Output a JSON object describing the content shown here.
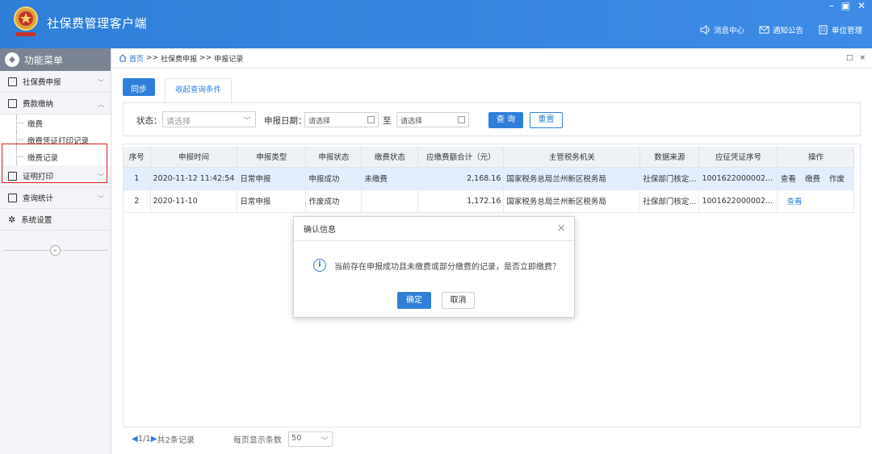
{
  "header": {
    "title": "社保费管理客户端",
    "logo_icon": "tax-emblem-icon",
    "window": {
      "minimize": "–",
      "restore": "▣",
      "close": "✕"
    },
    "links": [
      {
        "label": "消息中心",
        "icon": "speaker-icon"
      },
      {
        "label": "通知公告",
        "icon": "mail-icon"
      },
      {
        "label": "单位管理",
        "icon": "building-icon"
      }
    ]
  },
  "sidebar": {
    "title": "功能菜单",
    "items": [
      {
        "label": "社保费申报"
      },
      {
        "label": "费款缴纳"
      },
      {
        "label": "证明打印"
      },
      {
        "label": "查询统计"
      },
      {
        "label": "系统设置"
      }
    ],
    "sub_items": [
      "缴费",
      "缴费凭证打印记录",
      "缴费记录"
    ],
    "collapse": "«"
  },
  "breadcrumb": {
    "home": "首页",
    "sep": ">>",
    "level1": "社保费申报",
    "level2": "申报记录",
    "right_a": "□",
    "right_b": "×"
  },
  "toolbar": {
    "sync": "同步",
    "collapse_filter": "收起查询条件"
  },
  "filter": {
    "status_label": "状态：",
    "status_placeholder": "请选择",
    "date_label": "申报日期：",
    "date_from": "请选择",
    "to": "至",
    "date_to": "请选择",
    "query": "查 询",
    "reset": "重置"
  },
  "table": {
    "columns": [
      "序号",
      "申报时间",
      "申报类型",
      "申报状态",
      "缴费状态",
      "应缴费额合计（元）",
      "主管税务机关",
      "数据来源",
      "应征凭证序号",
      "操作"
    ],
    "rows": [
      {
        "no": "1",
        "time": "2020-11-12 11:42:54",
        "type": "日常申报",
        "status": "申报成功",
        "pay_status": "未缴费",
        "amount": "2,168.16",
        "authority": "国家税务总局兰州新区税务局",
        "source": "社保部门核定...",
        "voucher": "1001622000002...",
        "ops": [
          "查看",
          "缴费",
          "作废"
        ]
      },
      {
        "no": "2",
        "time": "2020-11-10",
        "type": "日常申报",
        "status": "作废成功",
        "pay_status": "",
        "amount": "1,172.16",
        "authority": "国家税务总局兰州新区税务局",
        "source": "社保部门核定...",
        "voucher": "1001622000002...",
        "ops": [
          "查看"
        ]
      }
    ]
  },
  "pager": {
    "prev": "◀",
    "page": "1/1",
    "next": "▶",
    "total": "共2条记录",
    "page_size_label": "每页显示条数",
    "page_size": "50"
  },
  "modal": {
    "title": "确认信息",
    "message": "当前存在申报成功且未缴费或部分缴费的记录，是否立即缴费？",
    "ok": "确定",
    "cancel": "取消",
    "close": "×"
  },
  "colors": {
    "primary": "#2f7fd9",
    "highlight": "#e01e1e",
    "sidebar_head": "#7a8493"
  }
}
